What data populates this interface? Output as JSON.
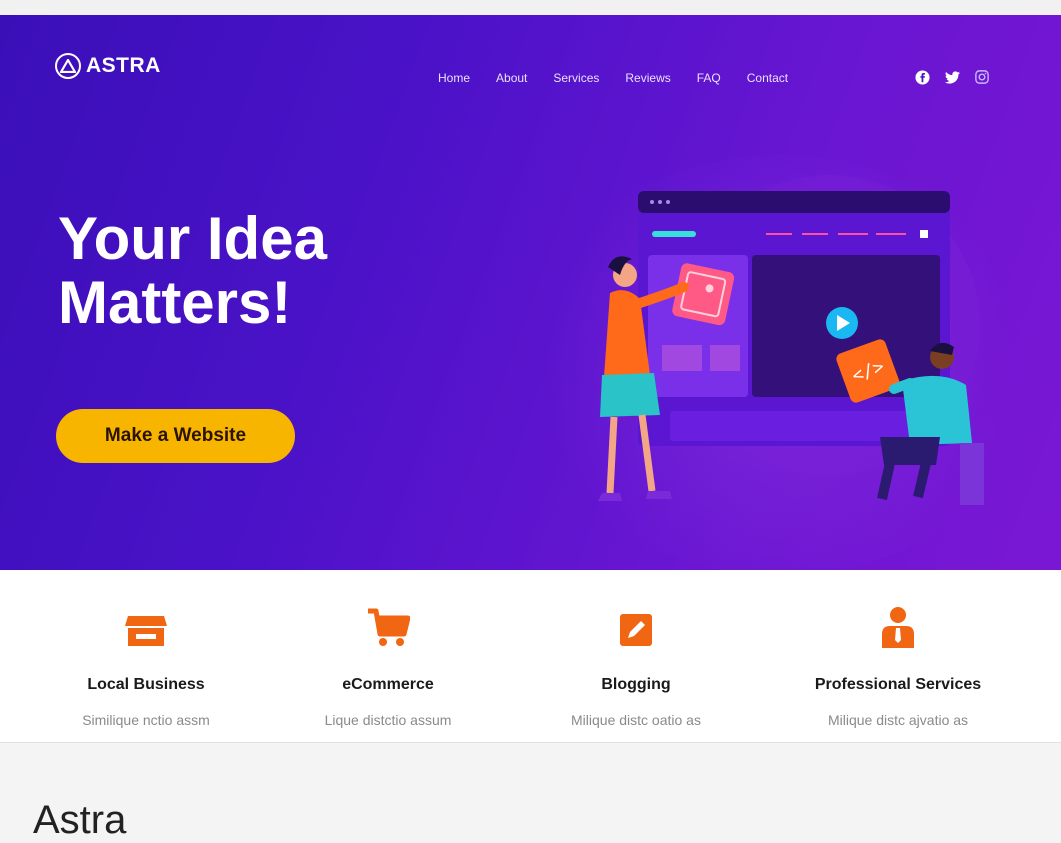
{
  "logo": {
    "text": "ASTRA"
  },
  "nav": [
    "Home",
    "About",
    "Services",
    "Reviews",
    "FAQ",
    "Contact"
  ],
  "social": [
    "facebook-icon",
    "twitter-icon",
    "instagram-icon"
  ],
  "hero": {
    "headline_line1": "Your Idea",
    "headline_line2": "Matters!",
    "cta_label": "Make a Website"
  },
  "features": [
    {
      "title": "Local Business",
      "desc": "Similique nctio assm",
      "icon": "store-icon"
    },
    {
      "title": "eCommerce",
      "desc": "Lique distctio assum",
      "icon": "cart-icon"
    },
    {
      "title": "Blogging",
      "desc": "Milique distc oatio as",
      "icon": "pencil-icon"
    },
    {
      "title": "Professional Services",
      "desc": "Milique distc ajvatio as",
      "icon": "businessman-icon"
    }
  ],
  "footer": {
    "site_name": "Astra"
  },
  "colors": {
    "accent": "#f7b500",
    "orange": "#f16612",
    "hero_start": "#3a0fb8",
    "hero_end": "#7a17d4"
  }
}
